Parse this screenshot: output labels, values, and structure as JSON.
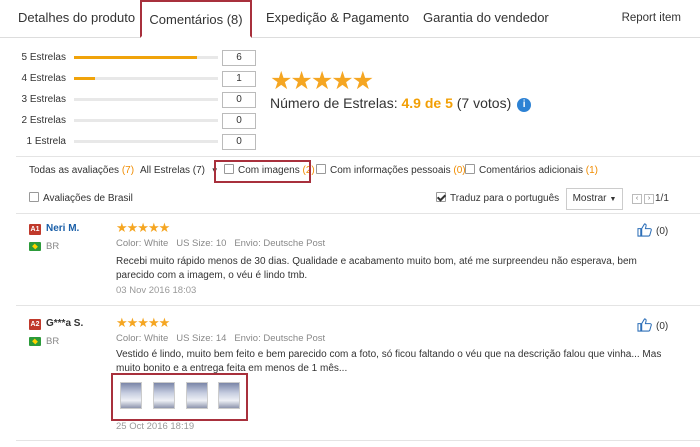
{
  "tabs": [
    {
      "label": "Detalhes do produto"
    },
    {
      "label": "Comentários (8)"
    },
    {
      "label": "Expedição & Pagamento"
    },
    {
      "label": "Garantia do vendedor"
    }
  ],
  "report_label": "Report item",
  "distribution": [
    {
      "label": "5 Estrelas",
      "count": "6",
      "fraction": 0.8571
    },
    {
      "label": "4 Estrelas",
      "count": "1",
      "fraction": 0.1429
    },
    {
      "label": "3 Estrelas",
      "count": "0",
      "fraction": 0
    },
    {
      "label": "2 Estrelas",
      "count": "0",
      "fraction": 0
    },
    {
      "label": "1 Estrela",
      "count": "0",
      "fraction": 0
    }
  ],
  "summary": {
    "stars": "★★★★★",
    "label": "Número de Estrelas:",
    "score": "4.9 de 5",
    "votes": "(7 votos)",
    "info_icon": "i"
  },
  "filters": {
    "all_label": "Todas as avaliações",
    "all_count": "(7)",
    "stars_select": "All Estrelas (7)",
    "with_images_label": "Com imagens",
    "with_images_count": "(2)",
    "personal_label": "Com informações pessoais",
    "personal_count": "(0)",
    "additional_label": "Comentários adicionais",
    "additional_count": "(1)",
    "brazil_label": "Avaliações de Brasil",
    "translate_label": "Traduz para o português",
    "sort_label": "Mostrar",
    "page_text": "1/1"
  },
  "reviews": [
    {
      "rank": "A1",
      "name": "Neri M.",
      "country": "BR",
      "stars": "★★★★★",
      "color_label": "Color:",
      "color": "White",
      "size_label": "US Size:",
      "size": "10",
      "ship_label": "Envio:",
      "ship": "Deutsche Post",
      "text": "Recebi muito rápido menos de 30 dias. Qualidade e acabamento muito bom, até me surpreendeu não esperava, bem parecido com a imagem, o véu é lindo tmb.",
      "date": "03 Nov 2016 18:03",
      "likes": "(0)"
    },
    {
      "rank": "A2",
      "name": "G***a S.",
      "country": "BR",
      "stars": "★★★★★",
      "color_label": "Color:",
      "color": "White",
      "size_label": "US Size:",
      "size": "14",
      "ship_label": "Envio:",
      "ship": "Deutsche Post",
      "text": "Vestido é lindo, muito bem feito e bem parecido com a foto, só ficou faltando o véu que na descrição falou que vinha... Mas muito bonito e a entrega feita em menos de 1 mês...",
      "date": "25 Oct 2016 18:19",
      "likes": "(0)"
    }
  ],
  "colors": {
    "accent_red": "#a8303c",
    "star_orange": "#f5a622",
    "link_blue": "#1a5fa8"
  }
}
